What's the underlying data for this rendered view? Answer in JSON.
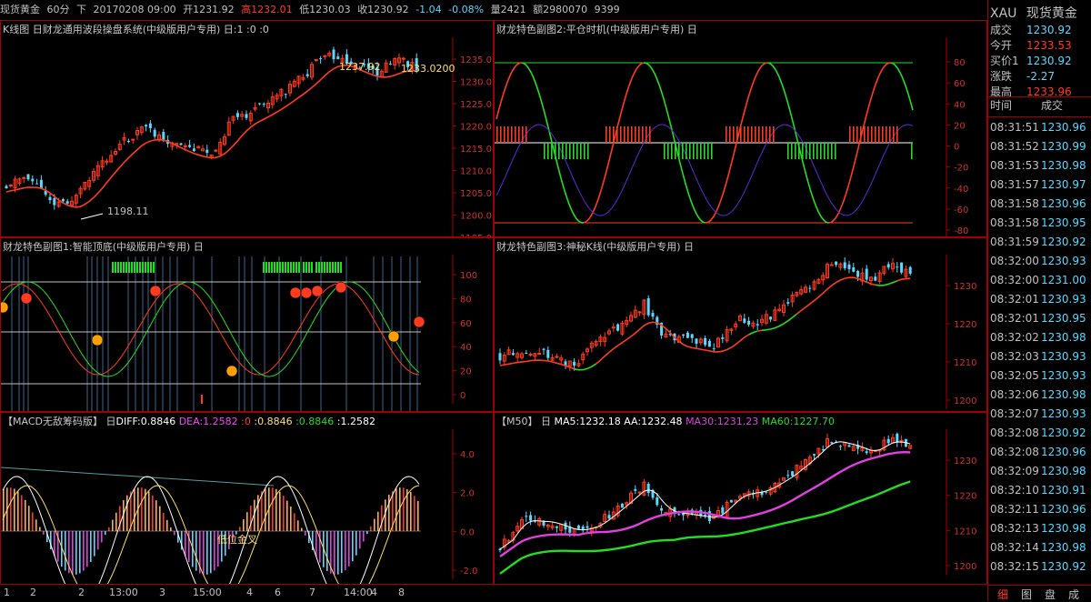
{
  "topbar": {
    "name": "现货黄金",
    "period": "60分",
    "mode": "下",
    "datetime": "20170208 09:00",
    "open": "开1231.92",
    "high": "高1232.01",
    "low": "低1230.03",
    "close": "收1230.92",
    "change": "-1.04",
    "pct": "-0.08%",
    "volume": "量2421",
    "amount": "额2980070",
    "extra": "9399"
  },
  "panels": {
    "kline": {
      "title": "K线图 日财龙通用波段操盘系统(中级版用户专用) 日:1 :0 :0",
      "low_mark": "1198.11",
      "high_mark": "1237.92",
      "last_mark": "1233.0200",
      "axis": [
        "1235.0",
        "1230.0",
        "1225.0",
        "1220.0",
        "1215.0",
        "1210.0",
        "1205.0",
        "1200.0",
        "1195.0"
      ]
    },
    "sub2": {
      "title": "财龙特色副图2:平仓时机(中级版用户专用) 日",
      "axis": [
        "80",
        "60",
        "40",
        "20",
        "0",
        "-20",
        "-40",
        "-60",
        "-80"
      ]
    },
    "sub1": {
      "title": "财龙特色副图1:智能顶底(中级版用户专用) 日",
      "axis": [
        "100",
        "80",
        "60",
        "40",
        "20",
        "0"
      ]
    },
    "sub3": {
      "title": "财龙特色副图3:神秘K线(中级版用户专用) 日",
      "axis": [
        "1230",
        "1220",
        "1210",
        "1200"
      ]
    },
    "macd": {
      "title": "【MACD无敌筹码版】 日",
      "diff": "DIFF:0.8846",
      "dea": "DEA:1.2582",
      "v1": ":0",
      "v2": ":0.8846",
      "v3": ":0.8846",
      "v4": ":1.2582",
      "cross_label": "低位金叉",
      "axis": [
        "4.0",
        "2.0",
        "0.0",
        "-2.0"
      ]
    },
    "ma": {
      "title": "【M50】 日",
      "ma5": "MA5:1232.18",
      "aa": "AA:1232.48",
      "ma30": "MA30:1231.23",
      "ma60": "MA60:1227.70",
      "axis": [
        "1230",
        "1220",
        "1210",
        "1200"
      ]
    }
  },
  "xaxis": [
    "1",
    "2",
    "2",
    "13:00",
    "3",
    "15:00",
    "4",
    "6",
    "7",
    "14:00",
    "4",
    "8"
  ],
  "colors": {
    "up": "#ff3b1f",
    "down": "#5ad8ff",
    "green": "#22dd22",
    "yellow": "#ffe060",
    "magenta": "#e040e0",
    "frame": "#a00000"
  },
  "quote": {
    "symbol": "XAU",
    "name": "现货黄金",
    "rows": [
      {
        "k": "成交",
        "v": "1230.92",
        "c": "#5ad8ff"
      },
      {
        "k": "今开",
        "v": "1233.53",
        "c": "#ff3b1f"
      },
      {
        "k": "买价1",
        "v": "1230.92",
        "c": "#5ad8ff"
      },
      {
        "k": "涨跌",
        "v": "-2.27",
        "c": "#5ad8ff"
      },
      {
        "k": "最高",
        "v": "1233.96",
        "c": "#ff3b1f"
      }
    ],
    "trade_header": {
      "time": "时间",
      "price": "成交"
    },
    "trades": [
      {
        "t": "08:31:51",
        "p": "1230.96"
      },
      {
        "t": "08:31:52",
        "p": "1230.99"
      },
      {
        "t": "08:31:53",
        "p": "1230.98"
      },
      {
        "t": "08:31:57",
        "p": "1230.97"
      },
      {
        "t": "08:31:58",
        "p": "1230.96"
      },
      {
        "t": "08:31:58",
        "p": "1230.95"
      },
      {
        "t": "08:31:59",
        "p": "1230.92"
      },
      {
        "t": "08:32:00",
        "p": "1230.93"
      },
      {
        "t": "08:32:00",
        "p": "1231.00"
      },
      {
        "t": "08:32:01",
        "p": "1230.93"
      },
      {
        "t": "08:32:01",
        "p": "1230.95"
      },
      {
        "t": "08:32:02",
        "p": "1230.98"
      },
      {
        "t": "08:32:03",
        "p": "1230.93"
      },
      {
        "t": "08:32:05",
        "p": "1230.93"
      },
      {
        "t": "08:32:06",
        "p": "1230.98"
      },
      {
        "t": "08:32:07",
        "p": "1230.93"
      },
      {
        "t": "08:32:08",
        "p": "1230.92"
      },
      {
        "t": "08:32:08",
        "p": "1230.96"
      },
      {
        "t": "08:32:09",
        "p": "1230.98"
      },
      {
        "t": "08:32:10",
        "p": "1230.91"
      },
      {
        "t": "08:32:11",
        "p": "1230.96"
      },
      {
        "t": "08:32:13",
        "p": "1230.98"
      },
      {
        "t": "08:32:14",
        "p": "1230.98"
      },
      {
        "t": "08:32:15",
        "p": "1230.92"
      }
    ],
    "buttons": [
      "细",
      "图",
      "盘",
      "成"
    ]
  }
}
